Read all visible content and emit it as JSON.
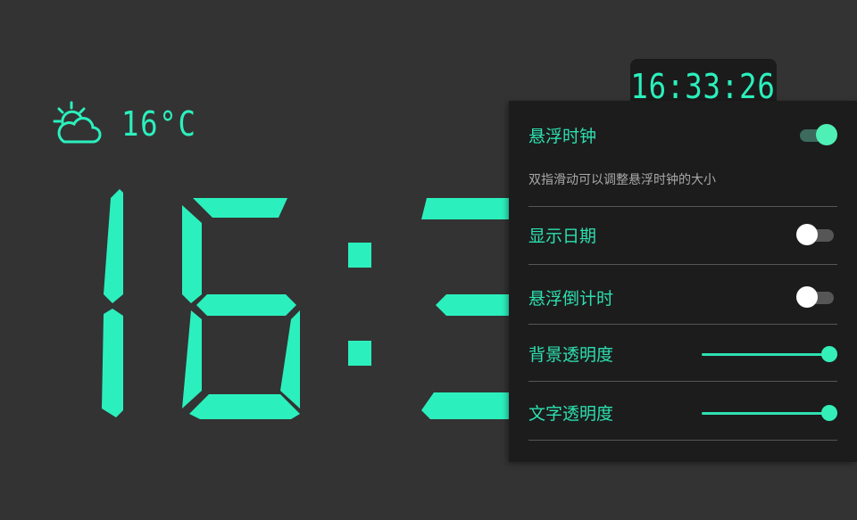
{
  "colors": {
    "accent": "#2bf0bd",
    "panel_bg": "#1c1c1c",
    "screen_bg": "#333333"
  },
  "weather": {
    "icon": "partly-cloudy-icon",
    "temperature": "16°C"
  },
  "big_clock": {
    "time_visible": "16:3"
  },
  "floating_clock": {
    "time": "16:33:26"
  },
  "settings": {
    "floating_clock": {
      "label": "悬浮时钟",
      "enabled": true,
      "hint": "双指滑动可以调整悬浮时钟的大小"
    },
    "show_date": {
      "label": "显示日期",
      "enabled": false
    },
    "floating_countdown": {
      "label": "悬浮倒计时",
      "enabled": false
    },
    "background_opacity": {
      "label": "背景透明度",
      "value_fraction": 1.0
    },
    "text_opacity": {
      "label": "文字透明度",
      "value_fraction": 1.0
    }
  }
}
